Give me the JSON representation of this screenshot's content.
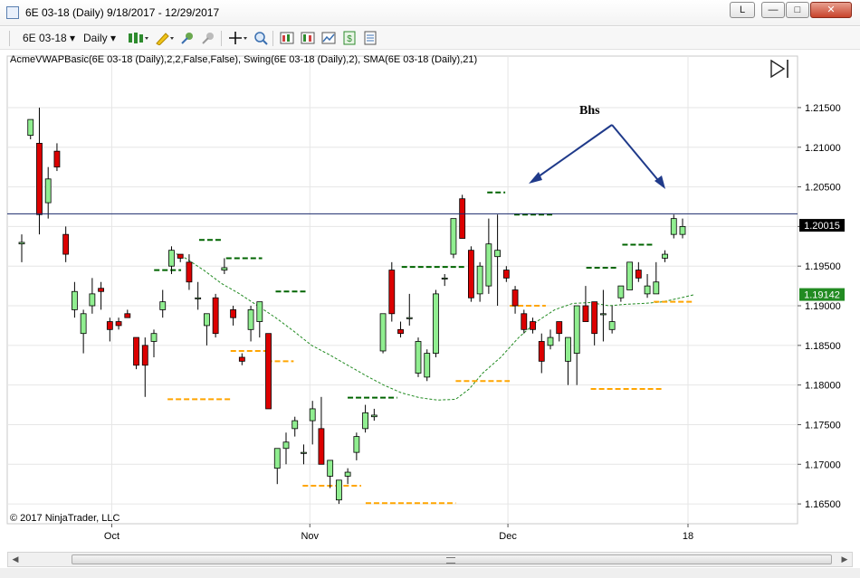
{
  "window": {
    "title": "6E 03-18 (Daily)  9/18/2017 - 12/29/2017",
    "buttons": {
      "l_label": "L",
      "minimize_label": "—",
      "maximize_label": "□",
      "close_label": "✕"
    }
  },
  "toolbar": {
    "instrument": "6E 03-18",
    "period": "Daily",
    "icons": [
      "bar-type-icon",
      "draw-tool-icon",
      "pin-icon",
      "magnet-icon",
      "crosshair-icon",
      "zoom-icon",
      "indicators-icon",
      "strategies-icon",
      "data-box-icon",
      "chart-trader-icon",
      "properties-icon"
    ]
  },
  "chart": {
    "indicator_label": "AcmeVWAPBasic(6E 03-18 (Daily),2,2,False,False), Swing(6E 03-18 (Daily),2), SMA(6E 03-18 (Daily),21)",
    "copyright": "© 2017 NinjaTrader, LLC",
    "annotation": "Bhs",
    "price_labels": {
      "current": "1.20015",
      "sma": "1.19142"
    },
    "colors": {
      "up": "#90ee90",
      "down": "#dc0000",
      "sma": "#228b22",
      "swing_high": "#006400",
      "swing_low": "#ffa500",
      "hline": "#1a2a6c",
      "arrow": "#1f3a8a"
    }
  },
  "chart_data": {
    "type": "candlestick",
    "title": "",
    "y_axis_ticks": [
      "1.21500",
      "1.21000",
      "1.20500",
      "1.20000",
      "1.19500",
      "1.19000",
      "1.18500",
      "1.18000",
      "1.17500",
      "1.17000",
      "1.16500"
    ],
    "x_axis_ticks": [
      "Oct",
      "Nov",
      "Dec",
      "18"
    ],
    "ylim": [
      1.1625,
      1.2215
    ],
    "hline": 1.2016,
    "candles": [
      {
        "o": 1.1978,
        "h": 1.199,
        "l": 1.1955,
        "c": 1.198
      },
      {
        "o": 1.2115,
        "h": 1.2135,
        "l": 1.211,
        "c": 1.2135
      },
      {
        "o": 1.2105,
        "h": 1.215,
        "l": 1.199,
        "c": 1.2015
      },
      {
        "o": 1.203,
        "h": 1.2075,
        "l": 1.201,
        "c": 1.206
      },
      {
        "o": 1.2095,
        "h": 1.2105,
        "l": 1.207,
        "c": 1.2075
      },
      {
        "o": 1.199,
        "h": 1.2,
        "l": 1.1955,
        "c": 1.1965
      },
      {
        "o": 1.1895,
        "h": 1.193,
        "l": 1.1885,
        "c": 1.1918
      },
      {
        "o": 1.1865,
        "h": 1.1895,
        "l": 1.184,
        "c": 1.189
      },
      {
        "o": 1.19,
        "h": 1.1935,
        "l": 1.189,
        "c": 1.1915
      },
      {
        "o": 1.1922,
        "h": 1.193,
        "l": 1.1895,
        "c": 1.1918
      },
      {
        "o": 1.188,
        "h": 1.1885,
        "l": 1.1855,
        "c": 1.187
      },
      {
        "o": 1.188,
        "h": 1.1885,
        "l": 1.187,
        "c": 1.1875
      },
      {
        "o": 1.189,
        "h": 1.1895,
        "l": 1.1885,
        "c": 1.1885
      },
      {
        "o": 1.186,
        "h": 1.186,
        "l": 1.182,
        "c": 1.1825
      },
      {
        "o": 1.185,
        "h": 1.186,
        "l": 1.1785,
        "c": 1.1825
      },
      {
        "o": 1.1855,
        "h": 1.187,
        "l": 1.1835,
        "c": 1.1865
      },
      {
        "o": 1.1895,
        "h": 1.192,
        "l": 1.1885,
        "c": 1.1905
      },
      {
        "o": 1.195,
        "h": 1.1975,
        "l": 1.194,
        "c": 1.197
      },
      {
        "o": 1.1965,
        "h": 1.1965,
        "l": 1.1955,
        "c": 1.196
      },
      {
        "o": 1.1955,
        "h": 1.1965,
        "l": 1.192,
        "c": 1.193
      },
      {
        "o": 1.191,
        "h": 1.193,
        "l": 1.1895,
        "c": 1.191
      },
      {
        "o": 1.1875,
        "h": 1.189,
        "l": 1.185,
        "c": 1.189
      },
      {
        "o": 1.191,
        "h": 1.1915,
        "l": 1.186,
        "c": 1.1865
      },
      {
        "o": 1.1945,
        "h": 1.196,
        "l": 1.194,
        "c": 1.1948
      },
      {
        "o": 1.1895,
        "h": 1.19,
        "l": 1.1875,
        "c": 1.1885
      },
      {
        "o": 1.1835,
        "h": 1.184,
        "l": 1.1825,
        "c": 1.183
      },
      {
        "o": 1.187,
        "h": 1.19,
        "l": 1.1855,
        "c": 1.1895
      },
      {
        "o": 1.188,
        "h": 1.1905,
        "l": 1.186,
        "c": 1.1905
      },
      {
        "o": 1.1865,
        "h": 1.1865,
        "l": 1.177,
        "c": 1.177
      },
      {
        "o": 1.1695,
        "h": 1.172,
        "l": 1.1675,
        "c": 1.172
      },
      {
        "o": 1.172,
        "h": 1.174,
        "l": 1.17,
        "c": 1.1728
      },
      {
        "o": 1.1745,
        "h": 1.176,
        "l": 1.1735,
        "c": 1.1755
      },
      {
        "o": 1.1715,
        "h": 1.1725,
        "l": 1.17,
        "c": 1.1715
      },
      {
        "o": 1.1755,
        "h": 1.178,
        "l": 1.1725,
        "c": 1.177
      },
      {
        "o": 1.1745,
        "h": 1.1785,
        "l": 1.17,
        "c": 1.17
      },
      {
        "o": 1.1685,
        "h": 1.1705,
        "l": 1.167,
        "c": 1.1705
      },
      {
        "o": 1.1655,
        "h": 1.168,
        "l": 1.165,
        "c": 1.168
      },
      {
        "o": 1.1685,
        "h": 1.1695,
        "l": 1.1675,
        "c": 1.169
      },
      {
        "o": 1.1715,
        "h": 1.174,
        "l": 1.1705,
        "c": 1.1735
      },
      {
        "o": 1.1745,
        "h": 1.1775,
        "l": 1.174,
        "c": 1.1765
      },
      {
        "o": 1.176,
        "h": 1.177,
        "l": 1.1755,
        "c": 1.1762
      },
      {
        "o": 1.1843,
        "h": 1.188,
        "l": 1.184,
        "c": 1.189
      },
      {
        "o": 1.1945,
        "h": 1.1955,
        "l": 1.188,
        "c": 1.189
      },
      {
        "o": 1.187,
        "h": 1.188,
        "l": 1.186,
        "c": 1.1865
      },
      {
        "o": 1.1885,
        "h": 1.1915,
        "l": 1.1875,
        "c": 1.1885
      },
      {
        "o": 1.1815,
        "h": 1.186,
        "l": 1.181,
        "c": 1.1855
      },
      {
        "o": 1.181,
        "h": 1.1845,
        "l": 1.1805,
        "c": 1.184
      },
      {
        "o": 1.184,
        "h": 1.192,
        "l": 1.1835,
        "c": 1.1915
      },
      {
        "o": 1.1935,
        "h": 1.194,
        "l": 1.1925,
        "c": 1.1935
      },
      {
        "o": 1.1965,
        "h": 1.201,
        "l": 1.196,
        "c": 1.201
      },
      {
        "o": 1.2035,
        "h": 1.204,
        "l": 1.1985,
        "c": 1.1985
      },
      {
        "o": 1.197,
        "h": 1.1975,
        "l": 1.1905,
        "c": 1.191
      },
      {
        "o": 1.1915,
        "h": 1.1955,
        "l": 1.1905,
        "c": 1.195
      },
      {
        "o": 1.1925,
        "h": 1.201,
        "l": 1.1915,
        "c": 1.1978
      },
      {
        "o": 1.1962,
        "h": 1.2015,
        "l": 1.19,
        "c": 1.197
      },
      {
        "o": 1.1945,
        "h": 1.195,
        "l": 1.193,
        "c": 1.1935
      },
      {
        "o": 1.192,
        "h": 1.1925,
        "l": 1.189,
        "c": 1.19
      },
      {
        "o": 1.189,
        "h": 1.1895,
        "l": 1.1865,
        "c": 1.187
      },
      {
        "o": 1.188,
        "h": 1.1885,
        "l": 1.1865,
        "c": 1.187
      },
      {
        "o": 1.1855,
        "h": 1.1865,
        "l": 1.1815,
        "c": 1.183
      },
      {
        "o": 1.185,
        "h": 1.187,
        "l": 1.1845,
        "c": 1.186
      },
      {
        "o": 1.188,
        "h": 1.188,
        "l": 1.1855,
        "c": 1.1865
      },
      {
        "o": 1.183,
        "h": 1.186,
        "l": 1.18,
        "c": 1.186
      },
      {
        "o": 1.184,
        "h": 1.19,
        "l": 1.18,
        "c": 1.19
      },
      {
        "o": 1.19,
        "h": 1.1925,
        "l": 1.188,
        "c": 1.188
      },
      {
        "o": 1.1905,
        "h": 1.1905,
        "l": 1.185,
        "c": 1.1865
      },
      {
        "o": 1.189,
        "h": 1.192,
        "l": 1.1855,
        "c": 1.189
      },
      {
        "o": 1.187,
        "h": 1.19,
        "l": 1.1865,
        "c": 1.188
      },
      {
        "o": 1.191,
        "h": 1.1925,
        "l": 1.1905,
        "c": 1.1925
      },
      {
        "o": 1.192,
        "h": 1.1955,
        "l": 1.192,
        "c": 1.1955
      },
      {
        "o": 1.1945,
        "h": 1.1955,
        "l": 1.193,
        "c": 1.1935
      },
      {
        "o": 1.1915,
        "h": 1.194,
        "l": 1.191,
        "c": 1.1925
      },
      {
        "o": 1.1915,
        "h": 1.1955,
        "l": 1.1915,
        "c": 1.193
      },
      {
        "o": 1.196,
        "h": 1.197,
        "l": 1.1955,
        "c": 1.1965
      },
      {
        "o": 1.199,
        "h": 1.2015,
        "l": 1.1985,
        "c": 1.201
      },
      {
        "o": 1.199,
        "h": 1.201,
        "l": 1.1985,
        "c": 1.2
      }
    ],
    "swing_highs": [
      {
        "start": 29,
        "end": 35,
        "price": 1.1945
      },
      {
        "start": 39,
        "end": 44,
        "price": 1.1983
      },
      {
        "start": 45,
        "end": 53,
        "price": 1.196
      },
      {
        "start": 56,
        "end": 63,
        "price": 1.1918
      },
      {
        "start": 72,
        "end": 83,
        "price": 1.1784
      },
      {
        "start": 84,
        "end": 98,
        "price": 1.1949
      },
      {
        "start": 103,
        "end": 107,
        "price": 1.2043
      },
      {
        "start": 109,
        "end": 118,
        "price": 1.2015
      },
      {
        "start": 125,
        "end": 132,
        "price": 1.1948
      },
      {
        "start": 133,
        "end": 140,
        "price": 1.1977
      }
    ],
    "swing_lows": [
      {
        "start": 32,
        "end": 46,
        "price": 1.1782
      },
      {
        "start": 46,
        "end": 54,
        "price": 1.1843
      },
      {
        "start": 54,
        "end": 60,
        "price": 1.183
      },
      {
        "start": 62,
        "end": 75,
        "price": 1.1673
      },
      {
        "start": 76,
        "end": 96,
        "price": 1.1651
      },
      {
        "start": 96,
        "end": 108,
        "price": 1.1805
      },
      {
        "start": 108,
        "end": 116,
        "price": 1.19
      },
      {
        "start": 126,
        "end": 142,
        "price": 1.1795
      },
      {
        "start": 140,
        "end": 149,
        "price": 1.1905
      }
    ],
    "sma": [
      {
        "i": 33,
        "v": 1.1968
      },
      {
        "i": 36,
        "v": 1.196
      },
      {
        "i": 40,
        "v": 1.1945
      },
      {
        "i": 44,
        "v": 1.1928
      },
      {
        "i": 48,
        "v": 1.1915
      },
      {
        "i": 52,
        "v": 1.19
      },
      {
        "i": 56,
        "v": 1.1885
      },
      {
        "i": 60,
        "v": 1.1868
      },
      {
        "i": 64,
        "v": 1.185
      },
      {
        "i": 68,
        "v": 1.1838
      },
      {
        "i": 72,
        "v": 1.1825
      },
      {
        "i": 76,
        "v": 1.1812
      },
      {
        "i": 80,
        "v": 1.18
      },
      {
        "i": 84,
        "v": 1.179
      },
      {
        "i": 88,
        "v": 1.1784
      },
      {
        "i": 92,
        "v": 1.1781
      },
      {
        "i": 96,
        "v": 1.1782
      },
      {
        "i": 99,
        "v": 1.1795
      },
      {
        "i": 102,
        "v": 1.1815
      },
      {
        "i": 106,
        "v": 1.1835
      },
      {
        "i": 110,
        "v": 1.186
      },
      {
        "i": 114,
        "v": 1.188
      },
      {
        "i": 118,
        "v": 1.1895
      },
      {
        "i": 122,
        "v": 1.1903
      },
      {
        "i": 126,
        "v": 1.1904
      },
      {
        "i": 130,
        "v": 1.19
      },
      {
        "i": 134,
        "v": 1.1902
      },
      {
        "i": 138,
        "v": 1.1903
      },
      {
        "i": 142,
        "v": 1.1905
      },
      {
        "i": 146,
        "v": 1.191
      },
      {
        "i": 149,
        "v": 1.1914
      }
    ]
  }
}
